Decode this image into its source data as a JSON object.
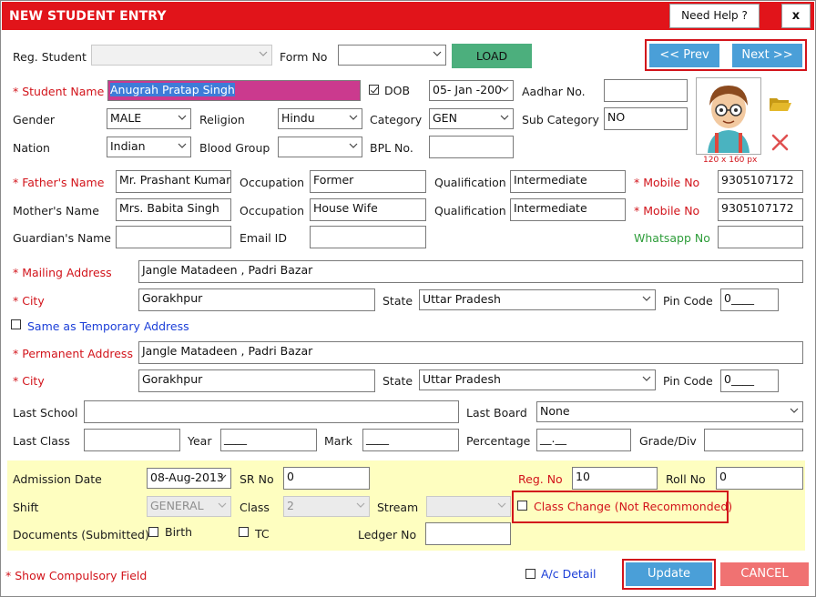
{
  "window": {
    "title": "NEW STUDENT ENTRY",
    "help_label": "Need Help ?",
    "close_label": "x"
  },
  "top": {
    "reg_student_label": "Reg. Student",
    "reg_student_value": "",
    "form_no_label": "Form No",
    "form_no_value": "",
    "load_label": "LOAD",
    "prev_label": "<< Prev",
    "next_label": "Next >>"
  },
  "personal": {
    "student_name_label": "* Student Name",
    "student_name_value": "Anugrah Pratap Singh",
    "dob_label": "DOB",
    "dob_value": "05- Jan -200",
    "aadhar_label": "Aadhar No.",
    "aadhar_value": "",
    "gender_label": "Gender",
    "gender_value": "MALE",
    "religion_label": "Religion",
    "religion_value": "Hindu",
    "category_label": "Category",
    "category_value": "GEN",
    "subcategory_label": "Sub Category",
    "subcategory_value": "NO",
    "nation_label": "Nation",
    "nation_value": "Indian",
    "blood_group_label": "Blood Group",
    "blood_group_value": "",
    "bpl_label": "BPL No.",
    "bpl_value": "",
    "photo_caption": "120 x 160 px"
  },
  "parents": {
    "father_label": "* Father's Name",
    "father_value": "Mr. Prashant Kumar Si",
    "occupation_label": "Occupation",
    "father_occupation": "Former",
    "qualification_label": "Qualification",
    "father_qualification": "Intermediate",
    "mobile_label": "* Mobile  No",
    "father_mobile": "9305107172",
    "mother_label": "Mother's Name",
    "mother_value": "Mrs. Babita Singh",
    "mother_occupation": "House Wife",
    "mother_qualification": "Intermediate",
    "mother_mobile_label": "* Mobile No",
    "mother_mobile": "9305107172",
    "guardian_label": "Guardian's Name",
    "guardian_value": "",
    "email_label": "Email ID",
    "email_value": "",
    "whatsapp_label": "Whatsapp No",
    "whatsapp_value": ""
  },
  "mailing": {
    "address_label": "* Mailing Address",
    "address_value": "Jangle Matadeen , Padri Bazar",
    "city_label": "* City",
    "city_value": "Gorakhpur",
    "state_label": "State",
    "state_value": "Uttar Pradesh",
    "pin_label": "Pin Code",
    "pin_value": "0____",
    "same_label": "Same as Temporary Address"
  },
  "permanent": {
    "address_label": "* Permanent Address",
    "address_value": "Jangle Matadeen , Padri Bazar",
    "city_label": "* City",
    "city_value": "Gorakhpur",
    "state_label": "State",
    "state_value": "Uttar Pradesh",
    "pin_label": "Pin Code",
    "pin_value": "0____"
  },
  "academic": {
    "last_school_label": "Last School",
    "last_school_value": "",
    "last_board_label": "Last Board",
    "last_board_value": "None",
    "last_class_label": "Last Class",
    "last_class_value": "",
    "year_label": "Year",
    "year_value": "____",
    "mark_label": "Mark",
    "mark_value": "____",
    "percentage_label": "Percentage",
    "percentage_value": "__.__",
    "grade_label": "Grade/Div",
    "grade_value": ""
  },
  "admission": {
    "date_label": "Admission Date",
    "date_value": "08-Aug-2013",
    "sr_label": "SR No",
    "sr_value": "0",
    "reg_no_label": "Reg. No",
    "reg_no_value": "10",
    "roll_label": "Roll No",
    "roll_value": "0",
    "shift_label": "Shift",
    "shift_value": "GENERAL",
    "class_label": "Class",
    "class_value": "2",
    "stream_label": "Stream",
    "stream_value": "",
    "class_change_label": "Class Change (Not Recommonded)",
    "documents_label": "Documents (Submitted)",
    "birth_label": "Birth",
    "tc_label": "TC",
    "ledger_label": "Ledger No",
    "ledger_value": ""
  },
  "footer": {
    "compulsory_label": "* Show Compulsory Field",
    "ac_detail_label": "A/c Detail",
    "update_label": "Update",
    "cancel_label": "CANCEL"
  },
  "colors": {
    "title_bar": "#e1141a",
    "load_button": "#4caf7d",
    "nav_button": "#4a9fd8",
    "update_button": "#4a9fd8",
    "cancel_button": "#f07272",
    "highlight_border": "#d2141b",
    "admission_panel": "#fefec0"
  }
}
